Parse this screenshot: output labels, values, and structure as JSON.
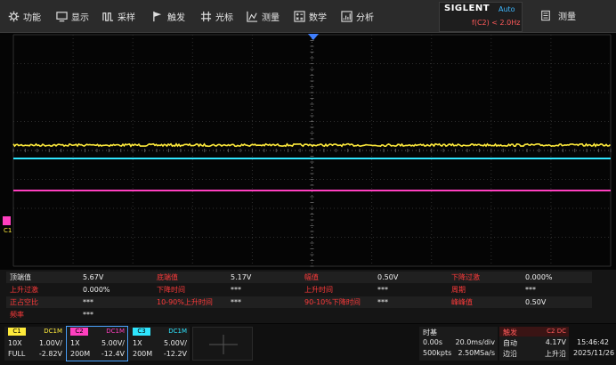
{
  "menu": [
    {
      "label": "功能",
      "icon": "gear-icon"
    },
    {
      "label": "显示",
      "icon": "display-icon"
    },
    {
      "label": "采样",
      "icon": "acquire-icon"
    },
    {
      "label": "触发",
      "icon": "trigger-flag-icon"
    },
    {
      "label": "光标",
      "icon": "cursor-icon"
    },
    {
      "label": "测量",
      "icon": "measure-icon"
    },
    {
      "label": "数学",
      "icon": "math-icon"
    },
    {
      "label": "分析",
      "icon": "analysis-icon"
    }
  ],
  "brand": {
    "logo": "SIGLENT",
    "mode": "Auto",
    "trigger_status": "f(C2) < 2.0Hz"
  },
  "measure_menu": {
    "label": "测量",
    "icon": "measure-panel-icon"
  },
  "channel_marker": "C1",
  "measurements": [
    [
      {
        "label": "顶端值",
        "value": "5.67V",
        "color": "#e8e8e8"
      },
      {
        "label": "底端值",
        "value": "5.17V",
        "color": "#ff3a3a"
      },
      {
        "label": "幅值",
        "value": "0.50V",
        "color": "#ff3a3a"
      },
      {
        "label": "下降过激",
        "value": "0.000%",
        "color": "#ff3a3a"
      }
    ],
    [
      {
        "label": "上升过激",
        "value": "0.000%",
        "color": "#ff3a3a"
      },
      {
        "label": "下降时间",
        "value": "***",
        "color": "#ff3a3a"
      },
      {
        "label": "上升时间",
        "value": "***",
        "color": "#ff3a3a"
      },
      {
        "label": "周期",
        "value": "***",
        "color": "#ff3a3a"
      }
    ],
    [
      {
        "label": "正占空比",
        "value": "***",
        "color": "#ff3a3a"
      },
      {
        "label": "10-90%上升时间",
        "value": "***",
        "color": "#ff3a3a"
      },
      {
        "label": "90-10%下降时间",
        "value": "***",
        "color": "#ff3a3a"
      },
      {
        "label": "峰峰值",
        "value": "0.50V",
        "color": "#ff3a3a"
      }
    ],
    [
      {
        "label": "频率",
        "value": "***",
        "color": "#ff3a3a"
      }
    ]
  ],
  "channels": [
    {
      "tag": "C1",
      "coupling": "DC1M",
      "probe": "10X",
      "scale": "1.00V/",
      "bw": "FULL",
      "offset": "-2.82V",
      "color": "#ffeb3b",
      "text_color": "#ffeb3b"
    },
    {
      "tag": "C2",
      "coupling": "DC1M",
      "probe": "1X",
      "scale": "5.00V/",
      "bw": "200M",
      "offset": "-12.4V",
      "color": "#ff3fbf",
      "text_color": "#ff3fbf"
    },
    {
      "tag": "C3",
      "coupling": "DC1M",
      "probe": "1X",
      "scale": "5.00V/",
      "bw": "200M",
      "offset": "-12.2V",
      "color": "#2fe6ff",
      "text_color": "#2fe6ff"
    }
  ],
  "timebase": {
    "title": "时基",
    "delay": "0.00s",
    "scale": "20.0ms/div",
    "points": "500kpts",
    "rate": "2.50MSa/s"
  },
  "trigger": {
    "title": "触发",
    "source": "C2 DC",
    "mode": "自动",
    "level": "4.17V",
    "type": "边沿",
    "slope": "上升沿"
  },
  "clock": {
    "time": "15:46:42",
    "date": "2025/11/26"
  },
  "colors": {
    "ch1": "#ffeb3b",
    "ch2": "#ff3fbf",
    "ch3": "#2fe6ff",
    "trigger_marker": "#3f7fff",
    "grid": "#2e2e2e"
  }
}
